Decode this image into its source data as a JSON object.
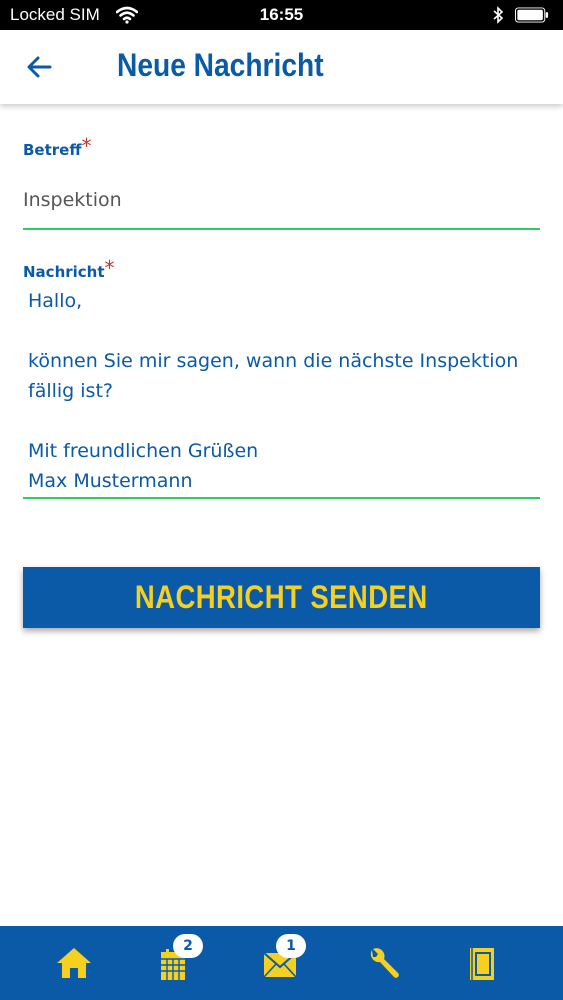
{
  "status_bar": {
    "carrier": "Locked SIM",
    "time": "16:55",
    "icons": [
      "wifi-icon",
      "bluetooth-icon",
      "battery-icon"
    ]
  },
  "header": {
    "title": "Neue Nachricht",
    "back_icon": "arrow-left-icon"
  },
  "form": {
    "subject": {
      "label": "Betreff",
      "required_mark": "*",
      "value": "Inspektion"
    },
    "message": {
      "label": "Nachricht",
      "required_mark": "*",
      "lines": [
        "Hallo,",
        "",
        "können Sie mir sagen, wann die nächste Inspektion",
        "fällig ist?",
        "",
        "Mit freundlichen Grüßen",
        "Max Mustermann"
      ]
    },
    "send_label": "NACHRICHT SENDEN"
  },
  "bottom_nav": {
    "items": [
      {
        "icon": "home-icon",
        "badge": ""
      },
      {
        "icon": "calendar-icon",
        "badge": "2"
      },
      {
        "icon": "mail-icon",
        "badge": "1"
      },
      {
        "icon": "wrench-icon",
        "badge": ""
      },
      {
        "icon": "document-icon",
        "badge": ""
      }
    ]
  },
  "colors": {
    "primary": "#0b5aa8",
    "accent": "#f5d020",
    "input_underline": "#2fcc66",
    "required": "#c0392b"
  }
}
